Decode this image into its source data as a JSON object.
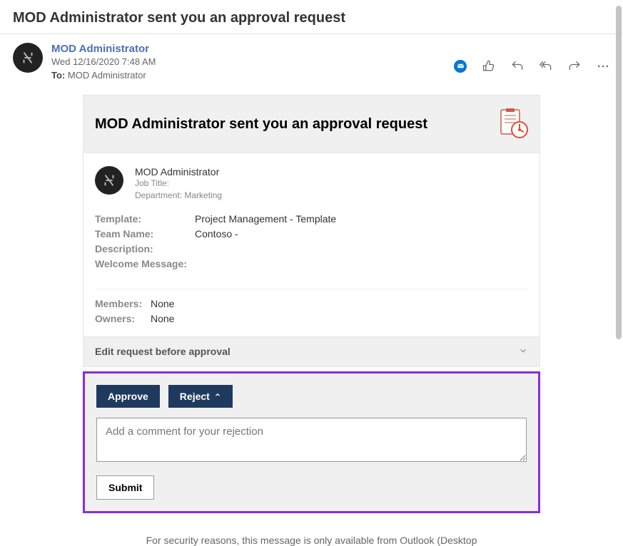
{
  "page": {
    "title": "MOD Administrator sent you an approval request"
  },
  "email": {
    "sender": "MOD Administrator",
    "timestamp": "Wed 12/16/2020 7:48 AM",
    "to_label": "To:",
    "to_value": "MOD Administrator"
  },
  "card": {
    "header_title": "MOD Administrator sent you an approval request",
    "requester": {
      "name": "MOD Administrator",
      "job_title_label": "Job Title:",
      "job_title_value": "",
      "department_label": "Department:",
      "department_value": "Marketing"
    },
    "details": {
      "template_label": "Template:",
      "template_value": "Project Management - Template",
      "team_name_label": "Team Name:",
      "team_name_value": "Contoso -",
      "description_label": "Description:",
      "description_value": "",
      "welcome_label": "Welcome Message:",
      "welcome_value": ""
    },
    "members": {
      "members_label": "Members:",
      "members_value": "None",
      "owners_label": "Owners:",
      "owners_value": "None"
    },
    "edit_label": "Edit request before approval"
  },
  "actions": {
    "approve_label": "Approve",
    "reject_label": "Reject",
    "comment_placeholder": "Add a comment for your rejection",
    "submit_label": "Submit"
  },
  "footer": "For security reasons, this message is only available from Outlook (Desktop"
}
